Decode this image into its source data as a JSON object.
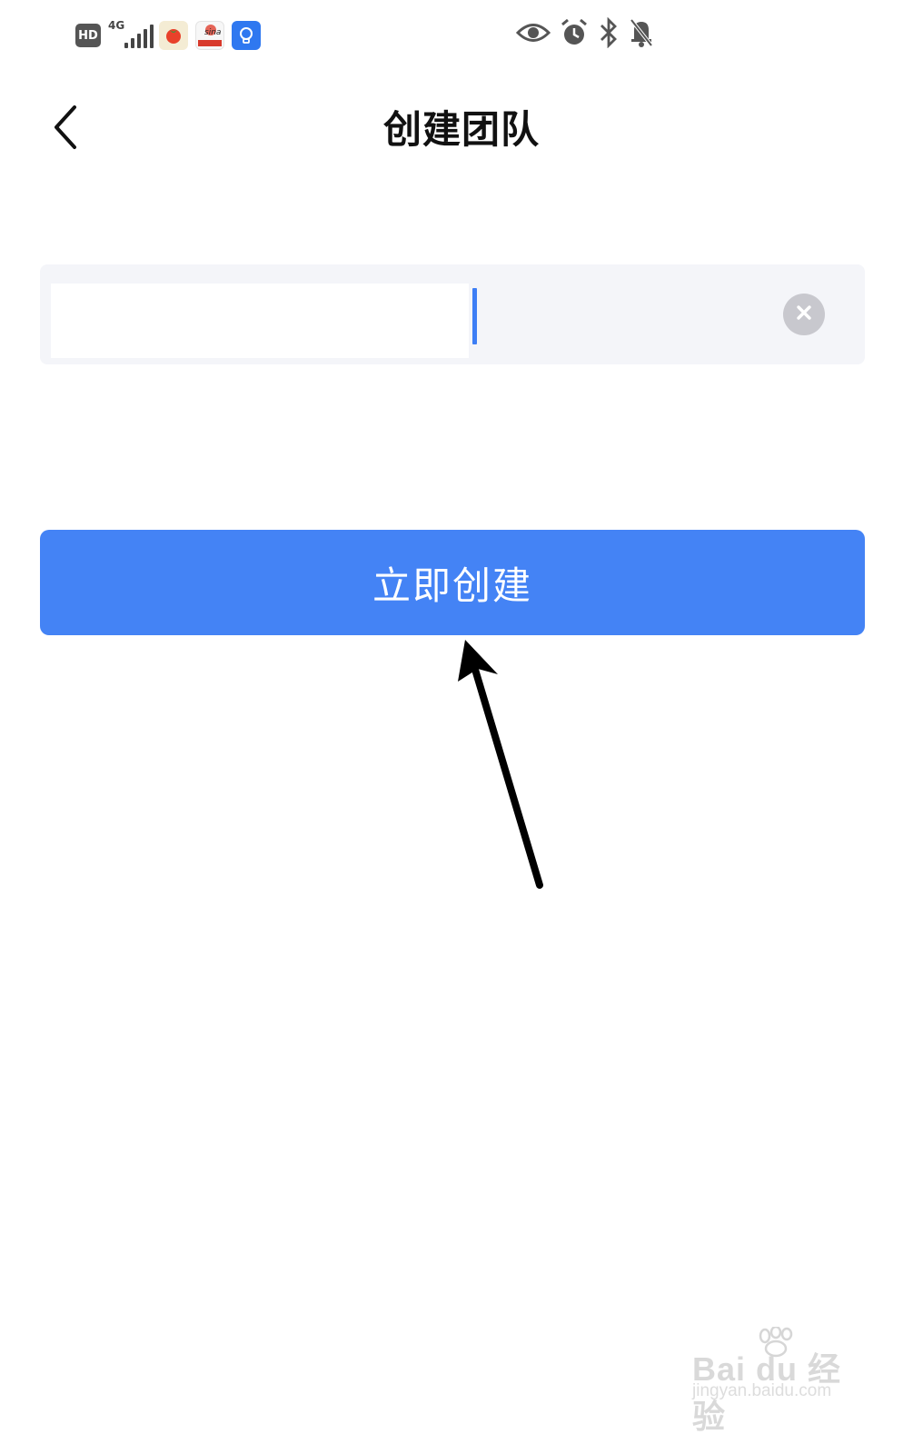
{
  "status_bar": {
    "hd_label": "HD",
    "network_label": "4G",
    "left_icons": [
      "hd-badge",
      "signal-icon",
      "tomato-app-icon",
      "sina-app-icon",
      "lightbulb-app-icon"
    ],
    "right_icons": [
      "eye-icon",
      "alarm-icon",
      "bluetooth-icon",
      "bell-off-icon"
    ]
  },
  "header": {
    "title": "创建团队",
    "back_icon": "chevron-left-icon"
  },
  "form": {
    "team_name_value": "",
    "clear_icon": "close-circle-icon"
  },
  "actions": {
    "create_label": "立即创建"
  },
  "colors": {
    "primary": "#4483f5",
    "input_background": "#f4f5f9",
    "caret": "#3d7ef5",
    "clear_button": "#c8c8ce"
  },
  "watermark": {
    "logo": "Bai du 经验",
    "url": "jingyan.baidu.com"
  }
}
